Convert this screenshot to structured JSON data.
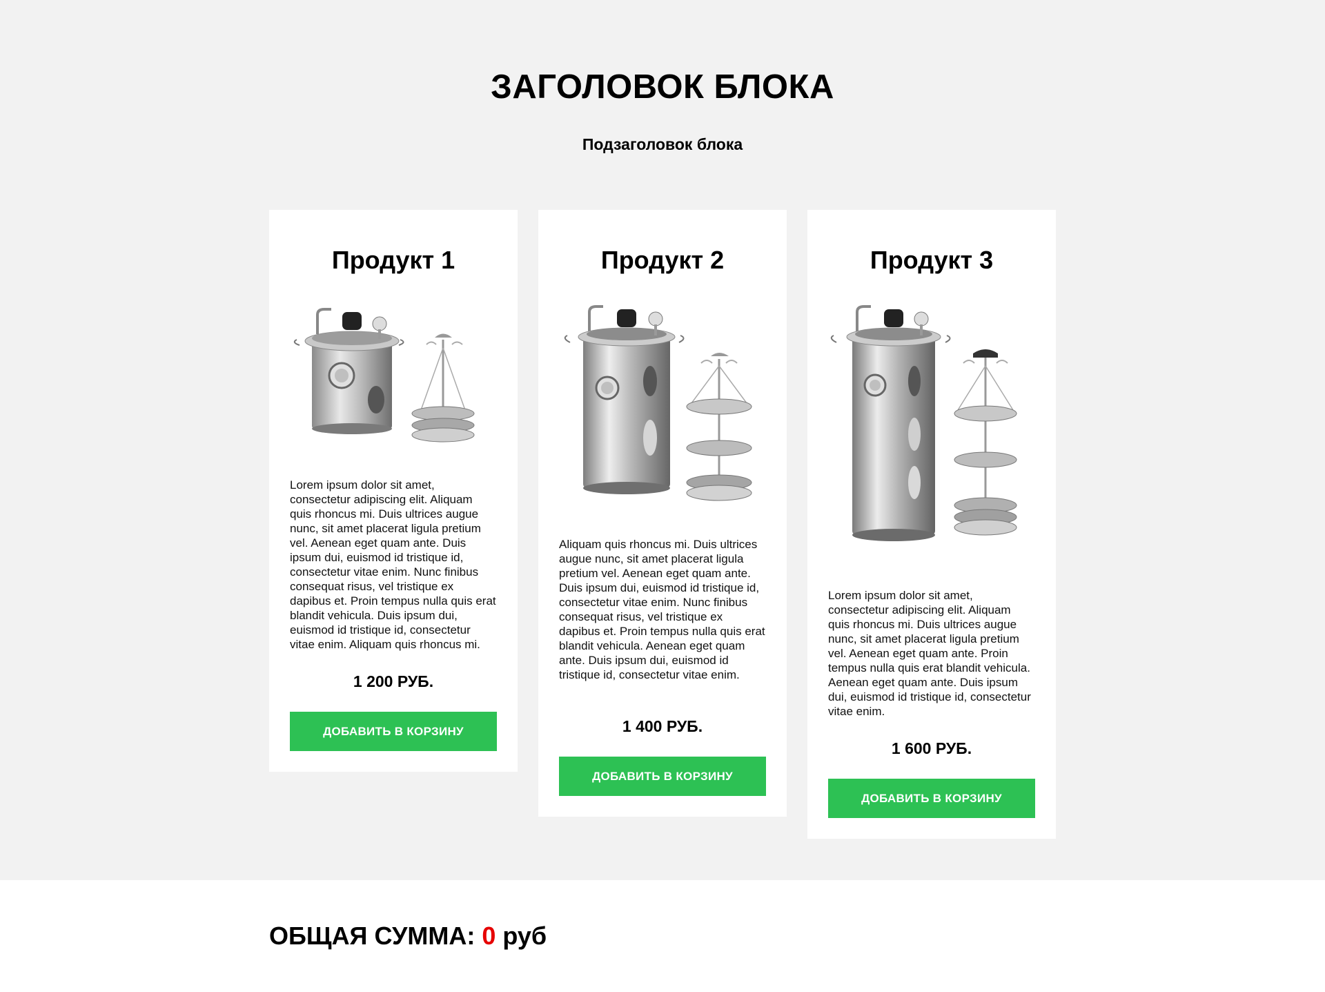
{
  "header": {
    "title": "ЗАГОЛОВОК БЛОКА",
    "subtitle": "Подзаголовок блока"
  },
  "products": [
    {
      "title": "Продукт 1",
      "description": "Lorem ipsum dolor sit amet, consectetur adipiscing elit. Aliquam quis rhoncus mi. Duis ultrices augue nunc, sit amet placerat ligula pretium vel. Aenean eget quam ante. Duis ipsum dui, euismod id tristique id, consectetur vitae enim. Nunc finibus consequat risus, vel tristique ex dapibus et. Proin tempus nulla quis erat blandit vehicula. Duis ipsum dui, euismod id tristique id, consectetur vitae enim. Aliquam quis rhoncus mi.",
      "price": "1 200 РУБ.",
      "button_label": "ДОБАВИТЬ В КОРЗИНУ",
      "trays": 2
    },
    {
      "title": "Продукт 2",
      "description": "Aliquam quis rhoncus mi. Duis ultrices augue nunc, sit amet placerat ligula pretium vel. Aenean eget quam ante. Duis ipsum dui, euismod id tristique id, consectetur vitae enim. Nunc finibus consequat risus, vel tristique ex dapibus et. Proin tempus nulla quis erat blandit vehicula. Aenean eget quam ante. Duis ipsum dui, euismod id tristique id, consectetur vitae enim.",
      "price": "1 400 РУБ.",
      "button_label": "ДОБАВИТЬ В КОРЗИНУ",
      "trays": 3
    },
    {
      "title": "Продукт 3",
      "description": "Lorem ipsum dolor sit amet, consectetur adipiscing elit. Aliquam quis rhoncus mi. Duis ultrices augue nunc, sit amet placerat ligula pretium vel. Aenean eget quam ante.  Proin tempus nulla quis erat blandit vehicula.  Aenean eget quam ante. Duis ipsum dui, euismod id tristique id, consectetur vitae enim.",
      "price": "1 600 РУБ.",
      "button_label": "ДОБАВИТЬ В КОРЗИНУ",
      "trays": 4
    }
  ],
  "footer": {
    "total_label": "ОБЩАЯ СУММА:",
    "total_value": "0",
    "total_unit": "руб"
  },
  "colors": {
    "background": "#f2f2f2",
    "card": "#ffffff",
    "button": "#2dc154",
    "total_value": "#e60000"
  },
  "icons": [
    "smokehouse-pot-image"
  ]
}
